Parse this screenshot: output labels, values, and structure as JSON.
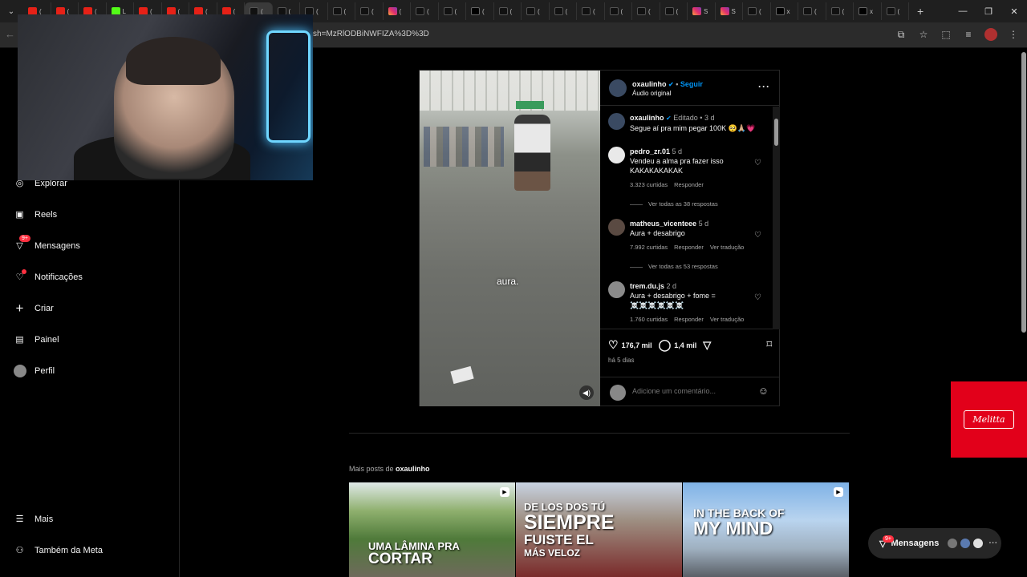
{
  "browser": {
    "tabs": [
      {
        "icon": "youtube-icon",
        "label": "("
      },
      {
        "icon": "youtube-icon",
        "label": "("
      },
      {
        "icon": "youtube-icon",
        "label": "("
      },
      {
        "icon": "kick-icon",
        "label": "L"
      },
      {
        "icon": "youtube-icon",
        "label": "("
      },
      {
        "icon": "youtube-icon",
        "label": "("
      },
      {
        "icon": "youtube-icon",
        "label": "("
      },
      {
        "icon": "youtube-icon",
        "label": "("
      },
      {
        "icon": "tiktok-icon",
        "label": "("
      },
      {
        "icon": "tiktok-icon",
        "label": "("
      },
      {
        "icon": "tiktok-icon",
        "label": "("
      },
      {
        "icon": "tiktok-icon",
        "label": "("
      },
      {
        "icon": "tiktok-icon",
        "label": "("
      },
      {
        "icon": "instagram-icon",
        "label": "("
      },
      {
        "icon": "tiktok-icon",
        "label": "("
      },
      {
        "icon": "tiktok-icon",
        "label": "("
      },
      {
        "icon": "x-icon",
        "label": "("
      },
      {
        "icon": "tiktok-icon",
        "label": "("
      },
      {
        "icon": "tiktok-icon",
        "label": "("
      },
      {
        "icon": "tiktok-icon",
        "label": "("
      },
      {
        "icon": "tiktok-icon",
        "label": "("
      },
      {
        "icon": "tiktok-icon",
        "label": "("
      },
      {
        "icon": "tiktok-icon",
        "label": "("
      },
      {
        "icon": "tiktok-icon",
        "label": "("
      },
      {
        "icon": "instagram-icon",
        "label": "S"
      },
      {
        "icon": "instagram-icon",
        "label": "S"
      },
      {
        "icon": "tiktok-icon",
        "label": "("
      },
      {
        "icon": "x-icon",
        "label": "x"
      },
      {
        "icon": "tiktok-icon",
        "label": "("
      },
      {
        "icon": "tiktok-icon",
        "label": "("
      },
      {
        "icon": "x-icon",
        "label": "x"
      },
      {
        "icon": "tiktok-icon",
        "label": "("
      }
    ],
    "url": "sh=MzRlODBiNWFIZA%3D%3D"
  },
  "sidebar": {
    "items": [
      {
        "label": "Explorar",
        "icon": "compass-icon"
      },
      {
        "label": "Reels",
        "icon": "reels-icon"
      },
      {
        "label": "Mensagens",
        "icon": "messenger-icon",
        "badge": "9+"
      },
      {
        "label": "Notificações",
        "icon": "heart-icon"
      },
      {
        "label": "Criar",
        "icon": "plus-icon"
      },
      {
        "label": "Painel",
        "icon": "dashboard-icon"
      },
      {
        "label": "Perfil",
        "icon": "profile-avatar"
      }
    ],
    "more": "Mais",
    "meta": "Também da Meta"
  },
  "post": {
    "username": "oxaulinho",
    "follow": "Seguir",
    "audio": "Áudio original",
    "overlay_text": "aura.",
    "caption": {
      "username": "oxaulinho",
      "edited": "Editado",
      "time": "3 d",
      "text": "Segue aí pra mim pegar 100K 🥺🙏🏼💗"
    },
    "comments": [
      {
        "username": "pedro_zr.01",
        "time": "5 d",
        "text": "Vendeu a alma pra fazer isso KAKAKAKAKAK",
        "likes": "3.323 curtidas",
        "reply": "Responder",
        "translate": "",
        "replies": "Ver todas as 38 respostas"
      },
      {
        "username": "matheus_vicenteee",
        "time": "5 d",
        "text": "Aura + desabrigo",
        "likes": "7.992 curtidas",
        "reply": "Responder",
        "translate": "Ver tradução",
        "replies": "Ver todas as 53 respostas"
      },
      {
        "username": "trem.du.js",
        "time": "2 d",
        "text": "Aura + desabrigo + fome = ☠️☠️☠️☠️☠️☠️",
        "likes": "1.760 curtidas",
        "reply": "Responder",
        "translate": "Ver tradução",
        "replies": ""
      }
    ],
    "like_count": "176,7 mil",
    "comment_count": "1,4 mil",
    "date": "há 5 dias",
    "add_comment_placeholder": "Adicione um comentário..."
  },
  "more_posts": {
    "prefix": "Mais posts de",
    "username": "oxaulinho",
    "thumbs": [
      {
        "text_line1": "UMA LÂMINA PRA",
        "text_line2": "CORTAR"
      },
      {
        "text_line1": "DE LOS DOS TÚ",
        "text_line2": "SIEMPRE",
        "text_line3": "FUISTE EL",
        "text_line4": "MÁS VELOZ"
      },
      {
        "text_line1": "IN THE BACK OF",
        "text_line2": "MY MIND"
      }
    ]
  },
  "ad": {
    "logo": "Melitta"
  },
  "messages_pill": {
    "label": "Mensagens",
    "badge": "9+"
  }
}
